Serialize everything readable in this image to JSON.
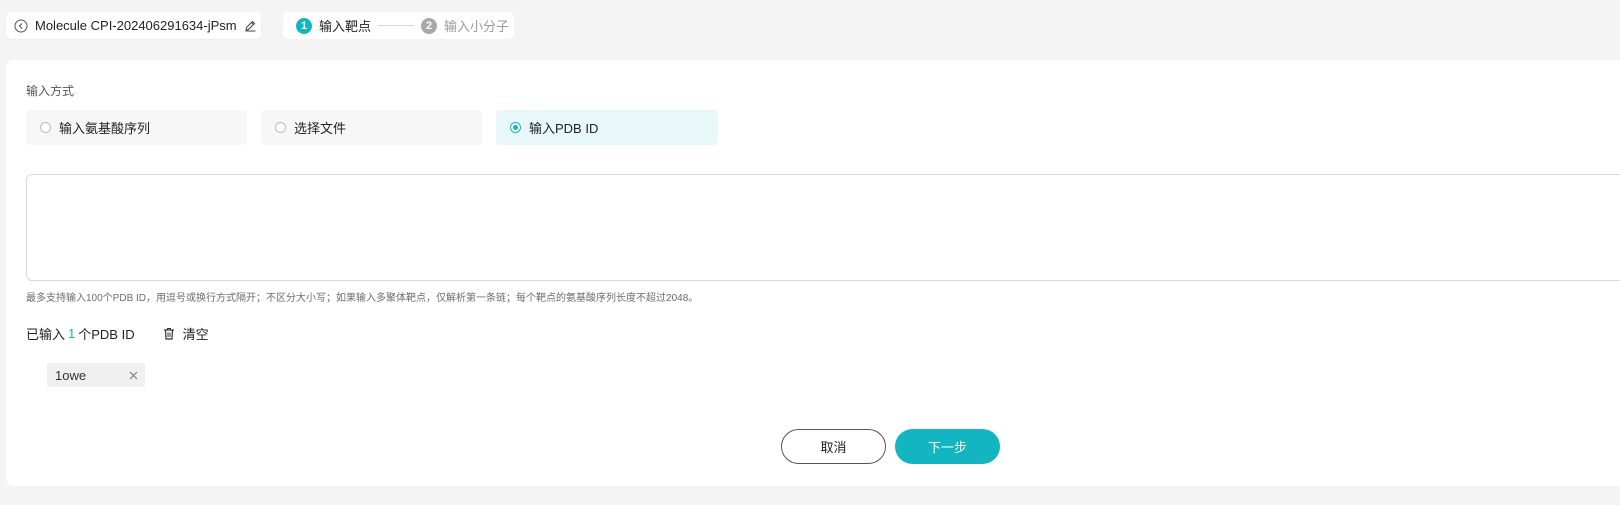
{
  "header": {
    "molecule_name": "Molecule CPI-202406291634-jPsm",
    "back_icon": "back-circle-icon",
    "edit_icon": "pencil-icon"
  },
  "steps": [
    {
      "number": "1",
      "label": "输入靶点",
      "active": true
    },
    {
      "number": "2",
      "label": "输入小分子",
      "active": false
    }
  ],
  "form": {
    "section_label": "输入方式",
    "options": [
      {
        "label": "输入氨基酸序列",
        "selected": false
      },
      {
        "label": "选择文件",
        "selected": false
      },
      {
        "label": "输入PDB ID",
        "selected": true
      }
    ],
    "textarea_value": "",
    "hint": "最多支持输入100个PDB ID，用逗号或换行方式隔开；不区分大小写；如果输入多聚体靶点，仅解析第一条链；每个靶点的氨基酸序列长度不超过2048。",
    "count_prefix": "已输入",
    "count": "1",
    "count_suffix": "个PDB ID",
    "clear_label": "清空",
    "tags": [
      "1owe"
    ]
  },
  "buttons": {
    "cancel": "取消",
    "next": "下一步"
  },
  "colors": {
    "accent": "#13b5c1",
    "selected_bg": "#e8f7f8",
    "page_bg": "#f4f4f4"
  }
}
